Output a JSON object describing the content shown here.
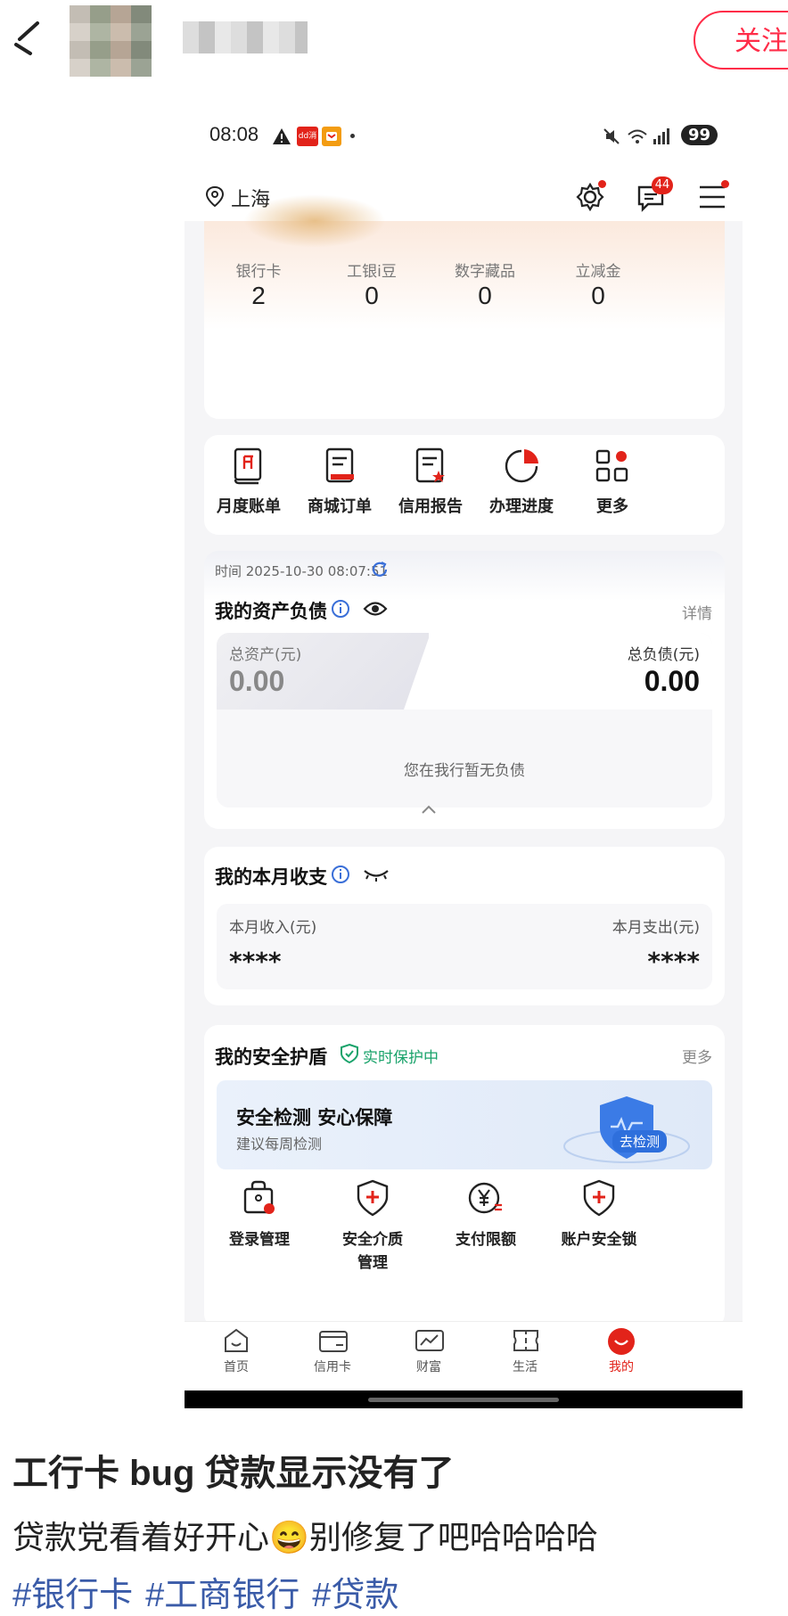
{
  "post_header": {
    "follow_label": "关注"
  },
  "phone": {
    "status_bar": {
      "time": "08:08",
      "app_badge_1": "dd消",
      "battery": "99"
    },
    "top_nav": {
      "location": "上海",
      "message_count": "44"
    },
    "stats": [
      {
        "label": "银行卡",
        "value": "2"
      },
      {
        "label": "工银i豆",
        "value": "0"
      },
      {
        "label": "数字藏品",
        "value": "0"
      },
      {
        "label": "立减金",
        "value": "0"
      }
    ],
    "tools": [
      {
        "label": "月度账单",
        "icon": "monthly-bill-icon"
      },
      {
        "label": "商城订单",
        "icon": "mall-order-icon"
      },
      {
        "label": "信用报告",
        "icon": "credit-report-icon"
      },
      {
        "label": "办理进度",
        "icon": "progress-icon"
      },
      {
        "label": "更多",
        "icon": "more-grid-icon"
      }
    ],
    "timestamp": "时间 2025-10-30 08:07:51",
    "assets": {
      "title": "我的资产负债",
      "detail": "详情",
      "total_assets_label": "总资产(元)",
      "total_assets_value": "0.00",
      "total_debt_label": "总负债(元)",
      "total_debt_value": "0.00",
      "no_debt_text": "您在我行暂无负债"
    },
    "monthly": {
      "title": "我的本月收支",
      "income_label": "本月收入(元)",
      "income_value": "****",
      "expense_label": "本月支出(元)",
      "expense_value": "****"
    },
    "security": {
      "title": "我的安全护盾",
      "status": "实时保护中",
      "more": "更多",
      "banner_title": "安全检测 安心保障",
      "banner_sub": "建议每周检测",
      "banner_button": "去检测",
      "items": [
        {
          "label": "登录管理",
          "icon": "login-manage-icon"
        },
        {
          "label": "安全介质",
          "label2": "管理",
          "icon": "security-medium-icon"
        },
        {
          "label": "支付限额",
          "icon": "payment-limit-icon"
        },
        {
          "label": "账户安全锁",
          "icon": "account-lock-icon"
        }
      ]
    },
    "tabbar": [
      {
        "label": "首页",
        "icon": "home-icon"
      },
      {
        "label": "信用卡",
        "icon": "credit-card-icon"
      },
      {
        "label": "财富",
        "icon": "wealth-icon"
      },
      {
        "label": "生活",
        "icon": "life-icon"
      },
      {
        "label": "我的",
        "icon": "mine-icon",
        "active": true
      }
    ],
    "colors": {
      "accent": "#e2231a",
      "link_blue": "#3a6fd8",
      "green": "#1aa36b"
    }
  },
  "caption": {
    "title": "工行卡 bug 贷款显示没有了",
    "body_before": "贷款党看着好开心",
    "emoji": "😄",
    "body_after": "别修复了吧哈哈哈哈",
    "tags": [
      "#银行卡",
      "#工商银行",
      "#贷款"
    ]
  }
}
